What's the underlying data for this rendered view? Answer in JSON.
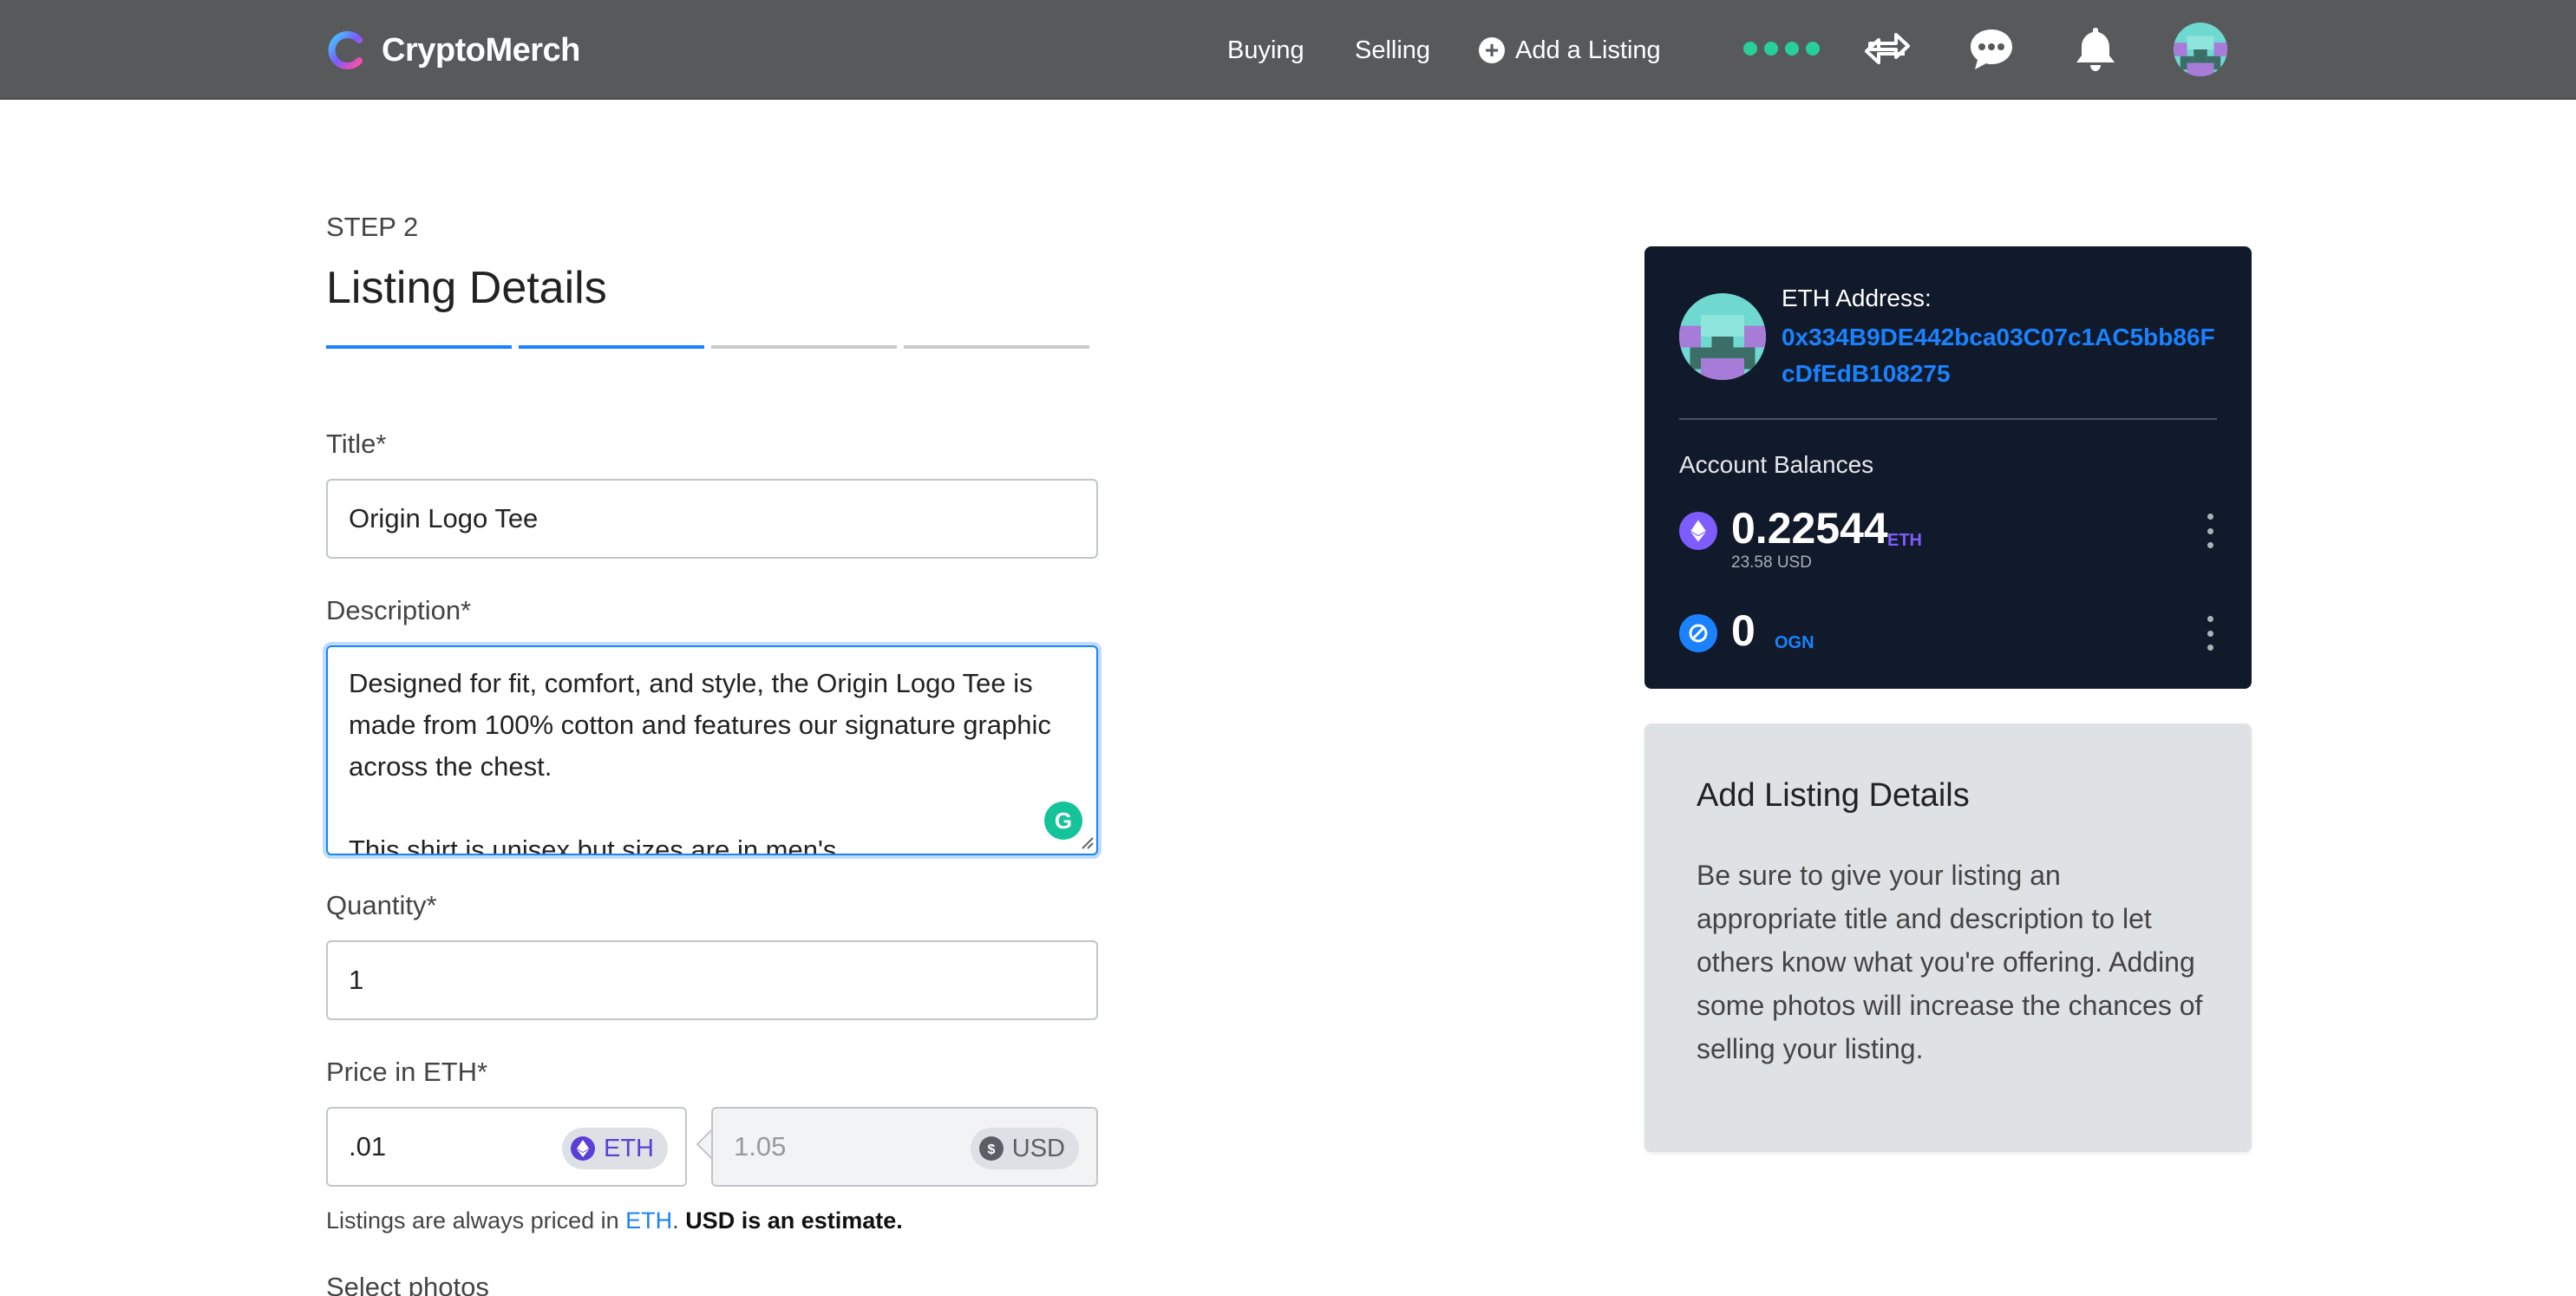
{
  "nav": {
    "brand": "CryptoMerch",
    "links": {
      "buying": "Buying",
      "selling": "Selling",
      "add_listing": "Add a Listing"
    },
    "icons": [
      "transfer-icon",
      "chat-icon",
      "bell-icon",
      "avatar"
    ],
    "status_color": "#26d198"
  },
  "form": {
    "step": "STEP 2",
    "heading": "Listing Details",
    "progress": {
      "total_steps": 4,
      "completed": 2
    },
    "title_label": "Title*",
    "title_value": "Origin Logo Tee",
    "description_label": "Description*",
    "description_value": "Designed for fit, comfort, and style, the Origin Logo Tee is made from 100% cotton and features our signature graphic across the chest.\n\nThis shirt is unisex but sizes are in men's",
    "quantity_label": "Quantity*",
    "quantity_value": "1",
    "price_label": "Price in ETH*",
    "price_eth_value": ".01",
    "price_eth_unit": "ETH",
    "price_usd_value": "1.05",
    "price_usd_unit": "USD",
    "note_prefix": "Listings are always priced in ",
    "note_link": "ETH",
    "note_dot": ". ",
    "note_bold": "USD is an estimate.",
    "photos_label": "Select photos"
  },
  "wallet": {
    "address_label": "ETH Address:",
    "address": "0x334B9DE442bca03C07c1AC5bb86FcDfEdB108275",
    "balances_label": "Account Balances",
    "eth_balance": "0.22544",
    "eth_unit": "ETH",
    "eth_usd": "23.58 USD",
    "ogn_balance": "0",
    "ogn_unit": "OGN",
    "eth_color": "#7f5cff",
    "ogn_color": "#1a82ff"
  },
  "info_card": {
    "title": "Add Listing Details",
    "body": "Be sure to give your listing an appropriate title and description to let others know what you're offering. Adding some photos will increase the chances of selling your listing."
  }
}
